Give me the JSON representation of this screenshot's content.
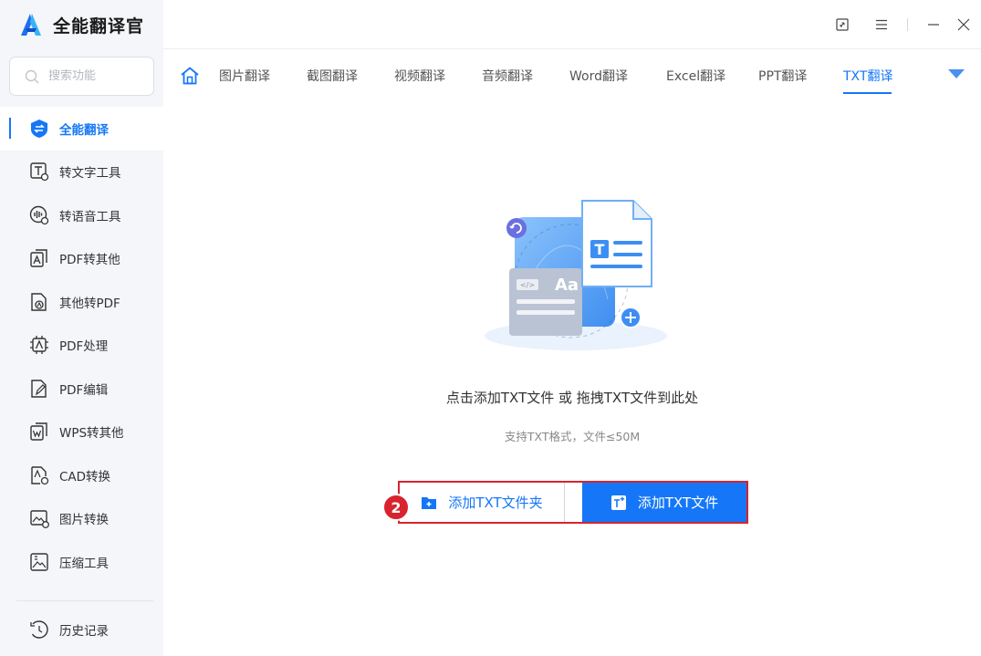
{
  "app": {
    "name": "全能翻译官",
    "accent": "#1577f7",
    "highlight": "#d9232e"
  },
  "search": {
    "placeholder": "搜索功能"
  },
  "sidebar": {
    "items": [
      {
        "label": "全能翻译",
        "icon": "translate-shield-icon",
        "active": true
      },
      {
        "label": "转文字工具",
        "icon": "text-tool-icon"
      },
      {
        "label": "转语音工具",
        "icon": "voice-tool-icon"
      },
      {
        "label": "PDF转其他",
        "icon": "pdf-convert-icon"
      },
      {
        "label": "其他转PDF",
        "icon": "to-pdf-icon"
      },
      {
        "label": "PDF处理",
        "icon": "pdf-process-icon"
      },
      {
        "label": "PDF编辑",
        "icon": "pdf-edit-icon"
      },
      {
        "label": "WPS转其他",
        "icon": "wps-convert-icon"
      },
      {
        "label": "CAD转换",
        "icon": "cad-convert-icon"
      },
      {
        "label": "图片转换",
        "icon": "image-convert-icon"
      },
      {
        "label": "压缩工具",
        "icon": "compress-icon"
      }
    ],
    "history": {
      "label": "历史记录",
      "icon": "history-icon"
    }
  },
  "tabs": {
    "items": [
      {
        "label": "图片翻译"
      },
      {
        "label": "截图翻译"
      },
      {
        "label": "视频翻译"
      },
      {
        "label": "音频翻译"
      },
      {
        "label": "Word翻译"
      },
      {
        "label": "Excel翻译"
      },
      {
        "label": "PPT翻译"
      },
      {
        "label": "TXT翻译",
        "active": true
      }
    ]
  },
  "main": {
    "drop_title": "点击添加TXT文件 或 拖拽TXT文件到此处",
    "drop_subtitle": "支持TXT格式，文件≤50M",
    "add_folder_label": "添加TXT文件夹",
    "add_file_label": "添加TXT文件",
    "step_badge": "2"
  }
}
